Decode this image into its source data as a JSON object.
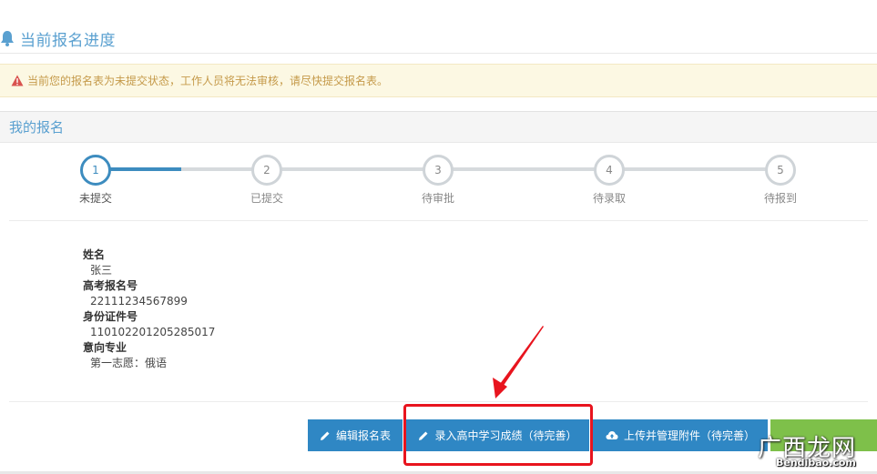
{
  "header": {
    "title": "当前报名进度",
    "icon": "bell-icon"
  },
  "alert": {
    "message": "当前您的报名表为未提交状态，工作人员将无法审核，请尽快提交报名表。",
    "icon": "warning-icon"
  },
  "panel": {
    "title": "我的报名"
  },
  "steps": [
    {
      "num": "1",
      "label": "未提交",
      "active": true
    },
    {
      "num": "2",
      "label": "已提交",
      "active": false
    },
    {
      "num": "3",
      "label": "待审批",
      "active": false
    },
    {
      "num": "4",
      "label": "待录取",
      "active": false
    },
    {
      "num": "5",
      "label": "待报到",
      "active": false
    }
  ],
  "info": {
    "name_label": "姓名",
    "name_value": "张三",
    "exam_label": "高考报名号",
    "exam_value": "22111234567899",
    "id_label": "身份证件号",
    "id_value": "110102201205285017",
    "major_label": "意向专业",
    "major_value": "第一志愿：俄语"
  },
  "buttons": {
    "edit": "编辑报名表",
    "grades": "录入高中学习成绩（待完善）",
    "upload": "上传并管理附件（待完善）"
  },
  "watermark": {
    "logo": "广西龙网",
    "url": "Bendibao.com"
  },
  "colors": {
    "accent": "#3d8cbf",
    "button": "#2f87c4",
    "alert_bg": "#fcf8e3",
    "alert_text": "#c59a4a",
    "highlight": "#e8141e"
  }
}
